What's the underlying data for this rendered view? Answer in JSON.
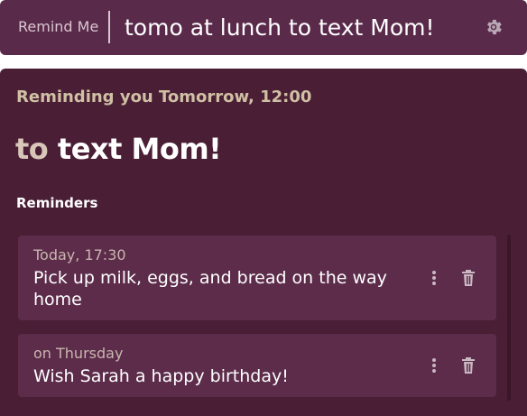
{
  "header": {
    "label": "Remind Me",
    "input_value": "tomo at lunch to text Mom!"
  },
  "preview": {
    "status": "Reminding you Tomorrow, 12:00",
    "title_prefix": "to",
    "title_text": "text Mom!"
  },
  "reminders": {
    "heading": "Reminders",
    "items": [
      {
        "when": "Today, 17:30",
        "text": "Pick up milk, eggs, and bread on the way home"
      },
      {
        "when": "on Thursday",
        "text": "Wish Sarah a happy birthday!"
      }
    ]
  },
  "icons": {
    "settings": "gear-icon",
    "more": "more-vertical-icon",
    "delete": "trash-icon"
  },
  "colors": {
    "header_bg": "#5a2a4b",
    "panel_bg": "#4a1e35",
    "card_bg": "#5c2c4a",
    "accent_text": "#cfc0a4"
  }
}
